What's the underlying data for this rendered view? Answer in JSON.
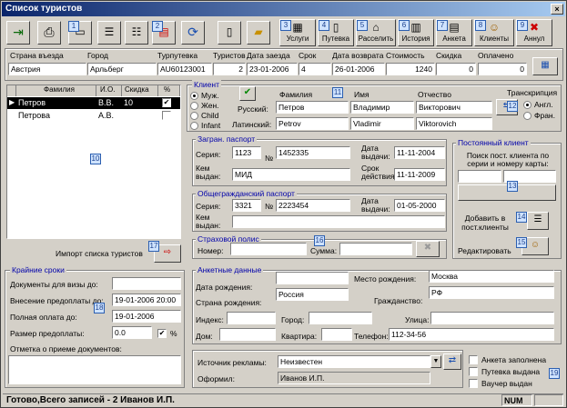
{
  "window": {
    "title": "Список туристов",
    "close": "×"
  },
  "toolbar": {
    "uslugi": "Услуги",
    "putevka": "Путевка",
    "rasselit": "Расселить",
    "istoriya": "История",
    "anketa": "Анкета",
    "klienty": "Клиенты",
    "annul": "Аннул"
  },
  "summary": {
    "headers": [
      "Страна въезда",
      "Город",
      "Турпутевка",
      "Туристов",
      "Дата заезда",
      "Срок",
      "Дата возврата",
      "Стоимость",
      "Скидка",
      "Оплачено"
    ],
    "values": [
      "Австрия",
      "Арльберг",
      "AU60123001",
      "2",
      "23-01-2006",
      "4",
      "26-01-2006",
      "1240",
      "0",
      "0"
    ]
  },
  "tourists": {
    "headers": [
      "Фамилия",
      "И.О.",
      "Скидка",
      "%"
    ],
    "rows": [
      {
        "surname": "Петров",
        "io": "В.В.",
        "discount": "10",
        "pct": "✔"
      },
      {
        "surname": "Петрова",
        "io": "А.В.",
        "discount": "",
        "pct": ""
      }
    ],
    "import_label": "Импорт списка туристов"
  },
  "client": {
    "title": "Клиент",
    "genders": [
      "Муж.",
      "Жен.",
      "Child",
      "Infant"
    ],
    "russian": "Русский:",
    "latin": "Латинский:",
    "col_surname": "Фамилия",
    "col_name": "Имя",
    "col_patronymic": "Отчество",
    "ru_surname": "Петров",
    "ru_name": "Владимир",
    "ru_patronymic": "Викторович",
    "lat_surname": "Petrov",
    "lat_name": "Vladimir",
    "lat_patronymic": "Viktorovich",
    "translit": "Транскрипция",
    "translit_opts": [
      "Англ.",
      "Фран."
    ]
  },
  "zagran": {
    "title": "Загран. паспорт",
    "seria": "Серия:",
    "seria_val": "1123",
    "nomer": "№",
    "nomer_val": "1452335",
    "issued_by": "Кем выдан:",
    "issued_val": "МИД",
    "date_label": "Дата выдачи:",
    "date_val": "11-11-2004",
    "valid_label": "Срок действия:",
    "valid_val": "11-11-2009"
  },
  "obsh": {
    "title": "Общегражданский паспорт",
    "seria": "Серия:",
    "seria_val": "3321",
    "nomer": "№",
    "nomer_val": "2223454",
    "issued_by": "Кем выдан:",
    "issued_val": "",
    "date_label": "Дата выдачи:",
    "date_val": "01-05-2000"
  },
  "insurance": {
    "title": "Страховой полис",
    "nomer": "Номер:",
    "summa": "Сумма:"
  },
  "permanent": {
    "title": "Постоянный клиент",
    "search_label": "Поиск пост. клиента по серии и номеру карты:",
    "add_label": "Добавить в пост.клиенты",
    "edit_label": "Редактировать"
  },
  "deadlines": {
    "title": "Крайние сроки",
    "visa_docs": "Документы для визы до:",
    "prepay": "Внесение предоплаты до:",
    "prepay_val": "19-01-2006 20:00",
    "full_pay": "Полная оплата до:",
    "full_pay_val": "19-01-2006",
    "prepay_size": "Размер предоплаты:",
    "prepay_size_val": "0.0",
    "pct": "%",
    "docs_mark": "Отметка о приеме документов:"
  },
  "anketa": {
    "title": "Анкетные данные",
    "birth_date": "Дата рождения:",
    "birth_place": "Место рождения:",
    "birth_place_val": "Москва",
    "birth_country": "Страна рождения:",
    "birth_country_val": "Россия",
    "citizenship": "Гражданство:",
    "citizenship_val": "РФ",
    "index": "Индекс:",
    "city": "Город:",
    "street": "Улица:",
    "house": "Дом:",
    "flat": "Квартира:",
    "phone": "Телефон:",
    "phone_val": "112-34-56"
  },
  "source": {
    "label": "Источник рекламы:",
    "value": "Неизвестен",
    "issued": "Оформил:",
    "issued_val": "Иванов И.П.",
    "checks": [
      "Анкета заполнена",
      "Путевка выдана",
      "Ваучер выдан"
    ]
  },
  "status": {
    "text": "Готово,Всего записей - 2 Иванов И.П.",
    "num": "NUM"
  },
  "callouts": [
    "1",
    "2",
    "3",
    "4",
    "5",
    "6",
    "7",
    "8",
    "9",
    "10",
    "11",
    "12",
    "13",
    "14",
    "15",
    "16",
    "17",
    "18",
    "19"
  ]
}
